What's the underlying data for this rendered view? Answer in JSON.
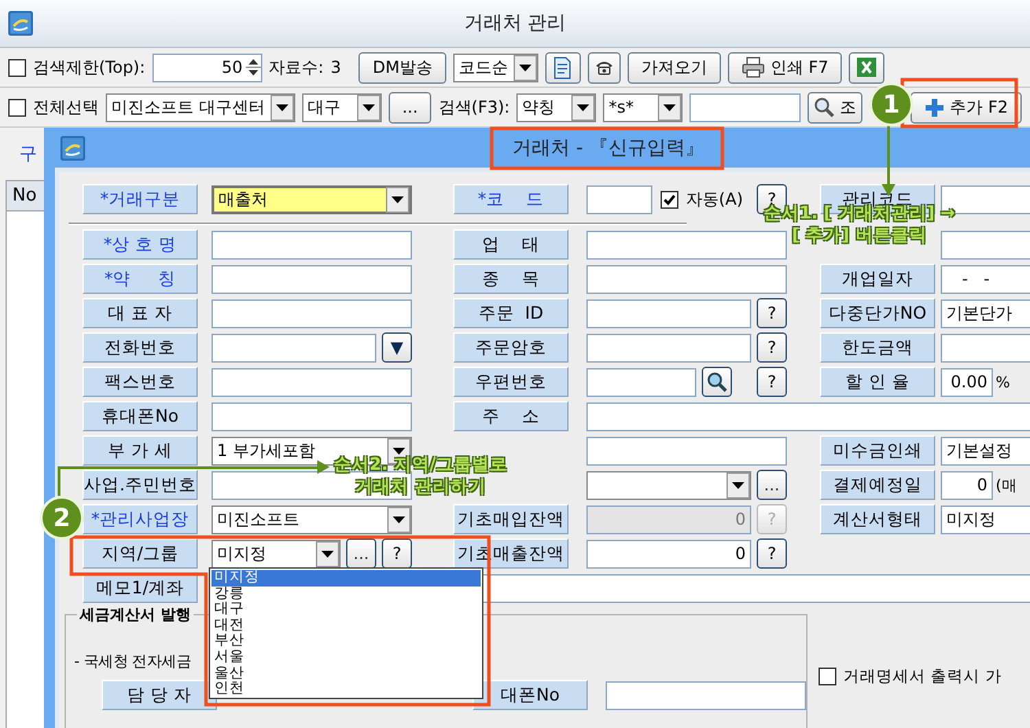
{
  "main": {
    "title": "거래처 관리",
    "toolbar_1": [
      {
        "kind": "checkbox",
        "label": "검색제한(Top):",
        "checked": false
      },
      {
        "kind": "spin",
        "value": "50"
      },
      {
        "kind": "text",
        "text": "자료수:"
      },
      {
        "kind": "text",
        "text": "3"
      },
      {
        "kind": "button",
        "label": "DM발송"
      },
      {
        "kind": "combo",
        "value": "코드순"
      },
      {
        "kind": "doc-button"
      },
      {
        "kind": "phone-button"
      },
      {
        "kind": "button",
        "label": "가져오기"
      },
      {
        "kind": "print-button",
        "label": "인쇄 F7"
      },
      {
        "kind": "sheet-button"
      }
    ],
    "toolbar_2": [
      {
        "kind": "checkbox",
        "label": "전체선택",
        "checked": false
      },
      {
        "kind": "combo",
        "value": "미진소프트 대구센터"
      },
      {
        "kind": "combo",
        "value": "대구"
      },
      {
        "kind": "button",
        "label": "..."
      },
      {
        "kind": "text",
        "text": "검색(F3):"
      },
      {
        "kind": "combo",
        "value": "약칭"
      },
      {
        "kind": "combo",
        "value": "*s*"
      },
      {
        "kind": "field"
      },
      {
        "kind": "search-button",
        "label": "조"
      },
      {
        "kind": "add-button",
        "label": "추가 F2"
      }
    ],
    "list_label": "구",
    "list_header": "No"
  },
  "dialog": {
    "title": "거래처 - 『신규입력』",
    "header_row": {
      "c1": {
        "label": "*거래구분",
        "required": true,
        "field": {
          "kind": "combo",
          "value": "매출처",
          "highlight": true
        }
      },
      "c2": {
        "label": "*코    드",
        "required": true,
        "field": {
          "kind": "text"
        },
        "extras": [
          {
            "kind": "checkbox",
            "label": "자동(A)",
            "checked": true
          },
          {
            "kind": "help",
            "label": "?"
          }
        ]
      },
      "c3": {
        "label": "관리코드",
        "field": {
          "kind": "text"
        }
      }
    },
    "rows": [
      {
        "c1": {
          "label": "*상 호 명",
          "required": true,
          "field": {
            "kind": "text"
          }
        },
        "c2": {
          "label": "업    태",
          "field": {
            "kind": "text"
          }
        },
        "c3": {
          "field": {
            "kind": "text"
          }
        }
      },
      {
        "c1": {
          "label": "*약     칭",
          "required": true,
          "field": {
            "kind": "text"
          }
        },
        "c2": {
          "label": "종    목",
          "field": {
            "kind": "text"
          }
        },
        "c3": {
          "label": "개업일자",
          "field": {
            "kind": "text",
            "value": "   -   -"
          }
        }
      },
      {
        "c1": {
          "label": "대 표 자",
          "field": {
            "kind": "text"
          }
        },
        "c2": {
          "label": "주문  ID",
          "field": {
            "kind": "text"
          },
          "extras": [
            {
              "kind": "help",
              "label": "?"
            }
          ]
        },
        "c3": {
          "label": "다중단가NO",
          "field": {
            "kind": "text",
            "value": "기본단가"
          }
        }
      },
      {
        "c1": {
          "label": "전화번호",
          "field": {
            "kind": "text"
          },
          "extras": [
            {
              "kind": "drop",
              "label": "▼"
            }
          ]
        },
        "c2": {
          "label": "주문암호",
          "field": {
            "kind": "text"
          },
          "extras": [
            {
              "kind": "help",
              "label": "?"
            }
          ]
        },
        "c3": {
          "label": "한도금액",
          "field": {
            "kind": "text"
          }
        }
      },
      {
        "c1": {
          "label": "팩스번호",
          "field": {
            "kind": "text"
          }
        },
        "c2": {
          "label": "우편번호",
          "field": {
            "kind": "text"
          },
          "extras": [
            {
              "kind": "lookup"
            },
            {
              "kind": "help",
              "label": "?"
            }
          ]
        },
        "c3": {
          "label": "할 인 율",
          "field": {
            "kind": "number",
            "value": "0.00"
          },
          "extras": [
            {
              "kind": "text",
              "text": "%"
            }
          ]
        }
      },
      {
        "c1": {
          "label": "휴대폰No",
          "field": {
            "kind": "text"
          }
        },
        "c2": {
          "label": "주    소",
          "field": {
            "kind": "text"
          }
        }
      },
      {
        "c1": {
          "label": "부 가 세",
          "field": {
            "kind": "combo",
            "value": "1 부가세포함"
          }
        },
        "c2": {
          "field": {
            "kind": "text"
          }
        },
        "c3": {
          "label": "미수금인쇄",
          "field": {
            "kind": "text",
            "value": "기본설정"
          }
        }
      },
      {
        "c1": {
          "label": "사업.주민번호",
          "field": {
            "kind": "text"
          }
        },
        "c2": {
          "field": {
            "kind": "combo"
          },
          "extras": [
            {
              "kind": "browse",
              "label": "..."
            }
          ]
        },
        "c3": {
          "label": "결제예정일",
          "field": {
            "kind": "number",
            "value": "0"
          },
          "extras": [
            {
              "kind": "text",
              "text": "(매"
            }
          ]
        }
      },
      {
        "c1": {
          "label": "*관리사업장",
          "required": true,
          "field": {
            "kind": "combo",
            "value": "미진소프트"
          }
        },
        "c2": {
          "label": "기초매입잔액",
          "field": {
            "kind": "number",
            "value": "0",
            "disabled": true
          },
          "extras": [
            {
              "kind": "help",
              "label": "?",
              "disabled": true
            }
          ]
        },
        "c3": {
          "label": "계산서형태",
          "field": {
            "kind": "text",
            "value": "미지정"
          }
        }
      },
      {
        "c1": {
          "label": "지역/그룹",
          "field": {
            "kind": "combo",
            "value": "미지정"
          },
          "extras": [
            {
              "kind": "browse",
              "label": "..."
            },
            {
              "kind": "help",
              "label": "?"
            }
          ]
        },
        "c2": {
          "label": "기초매출잔액",
          "field": {
            "kind": "number",
            "value": "0"
          },
          "extras": [
            {
              "kind": "help",
              "label": "?"
            }
          ]
        }
      },
      {
        "c1": {
          "label": "메모1/계좌",
          "field": {
            "kind": "text"
          }
        }
      }
    ],
    "tax_group": {
      "title": "세금계산서 발행",
      "note": "- 국세청 전자세금",
      "row": {
        "c1": {
          "label": "담 당 자"
        },
        "c2": {
          "label": "대폰No",
          "field": {
            "kind": "text"
          }
        }
      }
    },
    "side_option": {
      "label": "거래명세서 출력시 가",
      "checked": false
    },
    "dropdown": {
      "items": [
        {
          "label": "미지정",
          "selected": true
        },
        {
          "label": "강릉",
          "selected": false
        },
        {
          "label": "대구",
          "selected": false
        },
        {
          "label": "대전",
          "selected": false
        },
        {
          "label": "부산",
          "selected": false
        },
        {
          "label": "서울",
          "selected": false
        },
        {
          "label": "울산",
          "selected": false
        },
        {
          "label": "인천",
          "selected": false
        }
      ]
    }
  },
  "annotations": [
    {
      "number": "1",
      "lines": [
        "순서1. [ 거래처관리] →",
        "[ 추가] 버튼클릭"
      ]
    },
    {
      "number": "2",
      "lines": [
        "순서2. 지역/그룹별로",
        "거래처 관리하기"
      ]
    }
  ]
}
